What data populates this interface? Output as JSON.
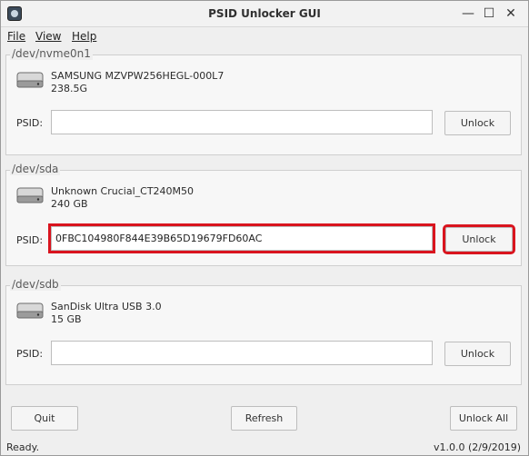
{
  "window": {
    "title": "PSID Unlocker GUI",
    "minimize": "—",
    "maximize": "☐",
    "close": "✕"
  },
  "menu": [
    {
      "label": "File"
    },
    {
      "label": "View"
    },
    {
      "label": "Help"
    }
  ],
  "devices": [
    {
      "path": "/dev/nvme0n1",
      "name": "SAMSUNG MZVPW256HEGL-000L7",
      "size": "238.5G",
      "psid_label": "PSID:",
      "psid_value": "",
      "unlock_label": "Unlock"
    },
    {
      "path": "/dev/sda",
      "name": "Unknown Crucial_CT240M50",
      "size": "240 GB",
      "psid_label": "PSID:",
      "psid_value": "0FBC104980F844E39B65D19679FD60AC",
      "unlock_label": "Unlock"
    },
    {
      "path": "/dev/sdb",
      "name": "SanDisk Ultra USB 3.0",
      "size": "15 GB",
      "psid_label": "PSID:",
      "psid_value": "",
      "unlock_label": "Unlock"
    }
  ],
  "buttons": {
    "quit": "Quit",
    "refresh": "Refresh",
    "unlock_all": "Unlock All"
  },
  "status": {
    "message": "Ready.",
    "version": "v1.0.0 (2/9/2019)"
  },
  "colors": {
    "highlight": "#d9141e"
  }
}
